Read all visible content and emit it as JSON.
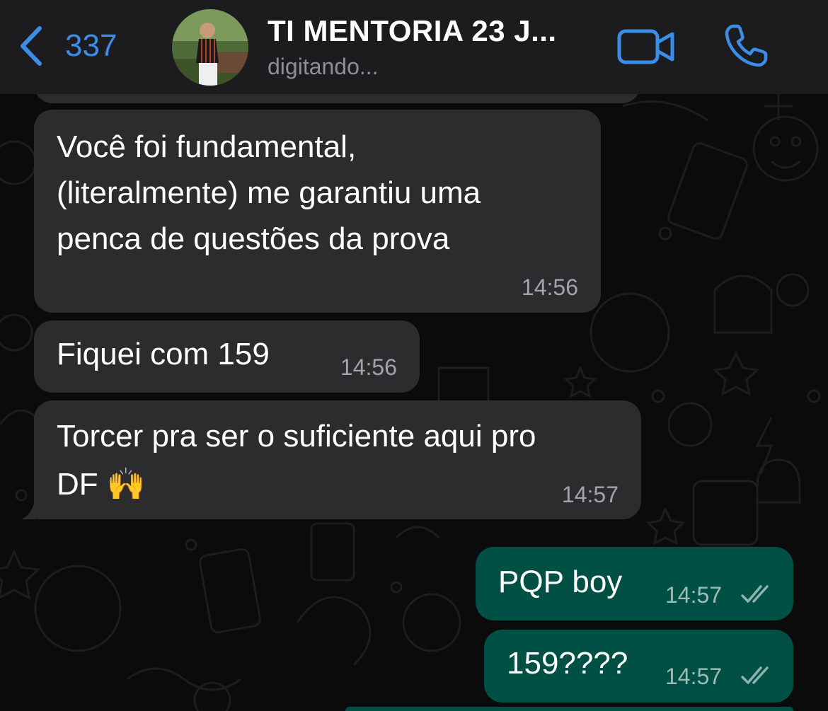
{
  "header": {
    "back_count": "337",
    "title": "TI MENTORIA 23 J...",
    "status": "digitando..."
  },
  "messages": [
    {
      "direction": "incoming",
      "lines": [
        "Você foi fundamental,",
        "(literalmente) me garantiu uma",
        "penca de questões da prova"
      ],
      "time": "14:56"
    },
    {
      "direction": "incoming",
      "lines": [
        "Fiquei com 159"
      ],
      "time": "14:56"
    },
    {
      "direction": "incoming",
      "lines": [
        "Torcer pra ser o suficiente aqui pro",
        "DF 🙌"
      ],
      "time": "14:57"
    },
    {
      "direction": "outgoing",
      "lines": [
        "PQP boy"
      ],
      "time": "14:57",
      "status": "read"
    },
    {
      "direction": "outgoing",
      "lines": [
        "159????"
      ],
      "time": "14:57",
      "status": "read"
    }
  ],
  "icons": {
    "back": "chevron-left-icon",
    "video": "video-camera-icon",
    "call": "phone-icon",
    "read_receipt": "double-check-icon"
  },
  "colors": {
    "accent": "#3a8de8",
    "incoming_bubble": "#2c2c2e",
    "outgoing_bubble": "#005046",
    "background": "#0b0b0c"
  }
}
